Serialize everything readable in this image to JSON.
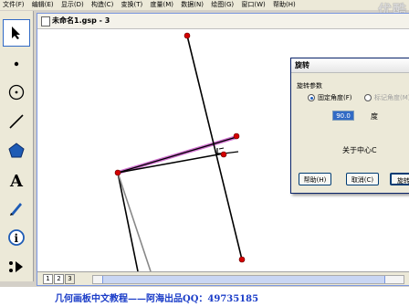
{
  "menu": [
    "文件(F)",
    "编辑(E)",
    "显示(D)",
    "构造(C)",
    "变换(T)",
    "度量(M)",
    "数据(N)",
    "绘图(G)",
    "窗口(W)",
    "帮助(H)"
  ],
  "watermark": "优酷",
  "document": {
    "title": "未命名1.gsp - 3"
  },
  "tools": [
    {
      "name": "arrow-tool-icon"
    },
    {
      "name": "point-tool-icon"
    },
    {
      "name": "compass-tool-icon"
    },
    {
      "name": "line-tool-icon"
    },
    {
      "name": "polygon-tool-icon"
    },
    {
      "name": "text-tool-icon"
    },
    {
      "name": "marker-tool-icon"
    },
    {
      "name": "information-tool-icon"
    },
    {
      "name": "custom-tool-icon"
    }
  ],
  "page_tabs": [
    "1",
    "2",
    "3"
  ],
  "dialog": {
    "title": "旋转",
    "group_label": "旋转参数",
    "radio_fixed": "固定角度(F)",
    "radio_marked": "标记角度(M)",
    "angle_value": "90.0",
    "angle_unit": "度",
    "center_text": "关于中心C",
    "help_button": "帮助(H)",
    "cancel_button": "取消(C)",
    "rotate_button": "旋转"
  },
  "caption": "几何画板中文教程——阿海出品QQ：49735185",
  "colors": {
    "accent": "#316ac5",
    "point": "#d40000",
    "highlight": "#d070d0",
    "caption": "#1a3cc8"
  }
}
